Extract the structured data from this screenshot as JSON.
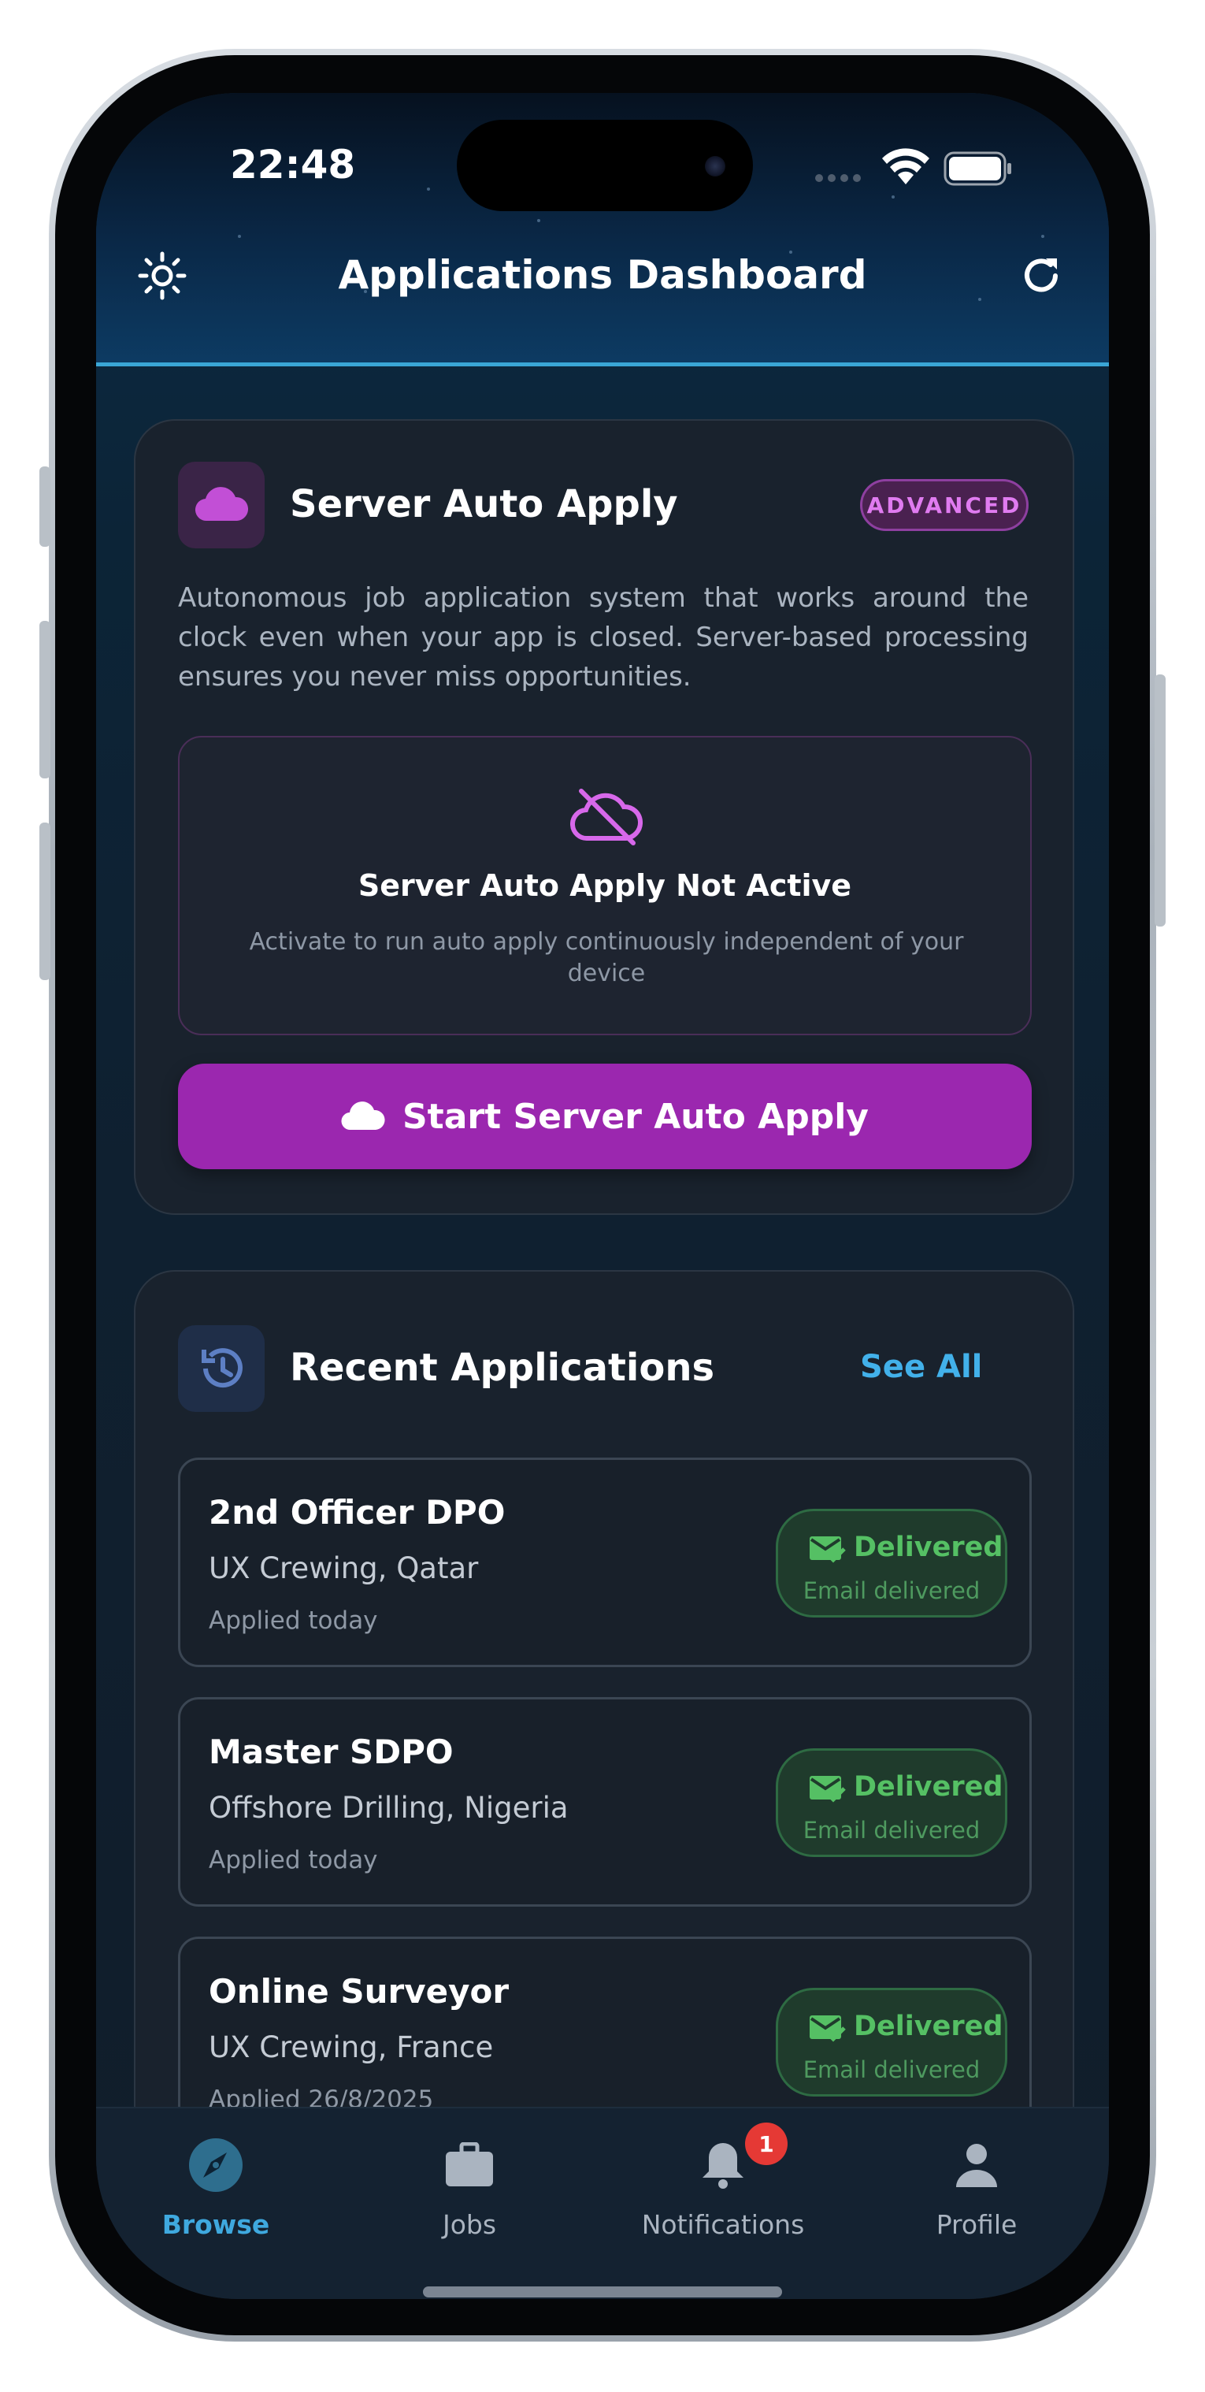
{
  "status_bar": {
    "time": "22:48"
  },
  "header": {
    "title": "Applications Dashboard",
    "left_icon": "sun-icon",
    "right_icon": "refresh-icon"
  },
  "server_auto_apply": {
    "title": "Server Auto Apply",
    "badge": "ADVANCED",
    "description": "Autonomous job application system that works around the clock even when your app is closed. Server-based processing ensures you never miss opportunities.",
    "status_title": "Server Auto Apply Not Active",
    "status_subtitle": "Activate to run auto apply continuously independent of your device",
    "button_label": "Start Server Auto Apply",
    "accent": "#9b27af"
  },
  "recent_applications": {
    "title": "Recent Applications",
    "see_all": "See All",
    "items": [
      {
        "title": "2nd Officer DPO",
        "company": "UX Crewing, Qatar",
        "date": "Applied today",
        "status": "Delivered",
        "status_detail": "Email delivered"
      },
      {
        "title": "Master SDPO",
        "company": "Offshore Drilling, Nigeria",
        "date": "Applied today",
        "status": "Delivered",
        "status_detail": "Email delivered"
      },
      {
        "title": "Online Surveyor",
        "company": "UX Crewing, France",
        "date": "Applied 26/8/2025",
        "status": "Delivered",
        "status_detail": "Email delivered"
      }
    ]
  },
  "bottom_nav": {
    "items": [
      {
        "label": "Browse",
        "icon": "compass-icon",
        "active": true
      },
      {
        "label": "Jobs",
        "icon": "briefcase-icon"
      },
      {
        "label": "Notifications",
        "icon": "bell-icon",
        "badge": "1"
      },
      {
        "label": "Profile",
        "icon": "person-icon"
      }
    ]
  }
}
